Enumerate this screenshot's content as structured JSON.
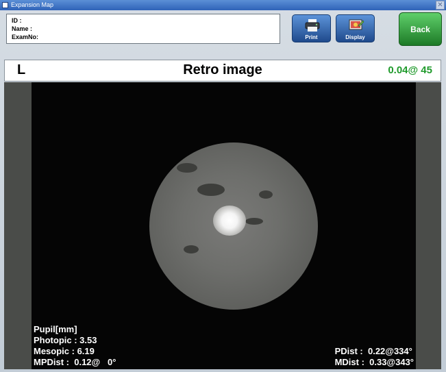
{
  "window": {
    "title": "Expansion Map"
  },
  "patient": {
    "id_label": "ID :",
    "name_label": "Name :",
    "examno_label": "ExamNo:"
  },
  "toolbar": {
    "print_label": "Print",
    "display_label": "Display",
    "back_label": "Back"
  },
  "header": {
    "eye": "L",
    "title": "Retro image",
    "value": "0.04@ 45"
  },
  "stats_left": {
    "heading": "Pupil[mm]",
    "photopic": "Photopic : 3.53",
    "mesopic": "Mesopic : 6.19",
    "mpdist": "MPDist :  0.12@   0°"
  },
  "stats_right": {
    "pdist": "PDist :  0.22@334°",
    "mdist": "MDist :  0.33@343°"
  },
  "colors": {
    "back_button": "#2f9a3a",
    "toolbar_button": "#2f62b8",
    "header_value": "#1f9a2b"
  },
  "icons": {
    "print": "printer-icon",
    "display": "display-icon"
  }
}
